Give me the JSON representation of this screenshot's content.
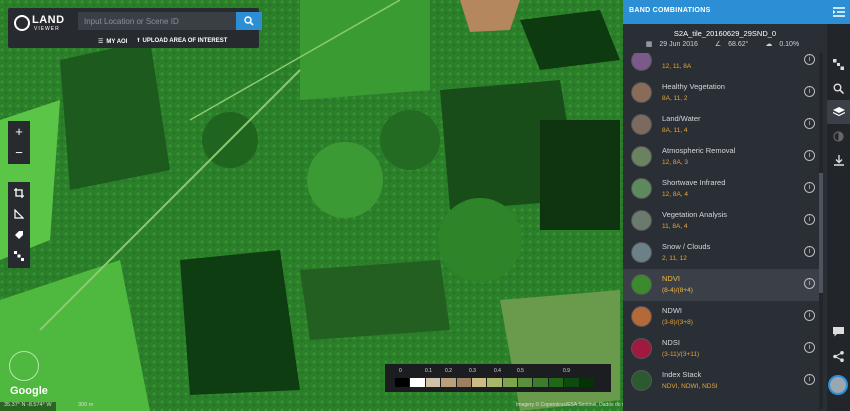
{
  "search": {
    "placeholder": "Input Location or Scene ID"
  },
  "logo": {
    "line1": "LAND",
    "line2": "VIEWER"
  },
  "aoi": {
    "my_aoi": "MY AOI",
    "upload": "UPLOAD AREA OF INTEREST"
  },
  "panel": {
    "title": "BAND COMBINATIONS",
    "tile": "S2A_tile_20160629_29SND_0",
    "date": "29 Jun 2016",
    "angle": "68.62°",
    "cloud": "0.10%"
  },
  "bands": [
    {
      "name": "",
      "combo": "12, 11, 8A",
      "color": "#7b5a8a"
    },
    {
      "name": "Healthy Vegetation",
      "combo": "8A, 11, 2",
      "color": "#8a6b58"
    },
    {
      "name": "Land/Water",
      "combo": "8A, 11, 4",
      "color": "#7a6a60"
    },
    {
      "name": "Atmospheric Removal",
      "combo": "12, 8A, 3",
      "color": "#6a8260"
    },
    {
      "name": "Shortwave Infrared",
      "combo": "12, 8A, 4",
      "color": "#5d8a5c"
    },
    {
      "name": "Vegetation Analysis",
      "combo": "11, 8A, 4",
      "color": "#6a7a6c"
    },
    {
      "name": "Snow / Clouds",
      "combo": "2, 11, 12",
      "color": "#6c8088"
    },
    {
      "name": "NDVI",
      "combo": "(8-4)/(8+4)",
      "color": "#3c8a2e"
    },
    {
      "name": "NDWI",
      "combo": "(3-8)/(3+8)",
      "color": "#b46a38"
    },
    {
      "name": "NDSI",
      "combo": "(3-11)/(3+11)",
      "color": "#a01a40"
    },
    {
      "name": "Index Stack",
      "combo": "NDVI, NDWI, NDSI",
      "color": "#2c5a30"
    }
  ],
  "legend": {
    "labels": [
      "0",
      "0.1",
      "0.2",
      "0.3",
      "0.4",
      "0.5",
      "0.9"
    ],
    "colors": [
      "#000000",
      "#ffffff",
      "#cfc2a9",
      "#b8a07c",
      "#9a8060",
      "#cabc84",
      "#a7b868",
      "#7ea44e",
      "#5a903c",
      "#3c7c2c",
      "#206818",
      "#0e4a10",
      "#063208"
    ]
  },
  "footer": {
    "coords": "35.37° N -8.574° W",
    "scale": "300 m",
    "credits": "Imagery © Copernicus/ESA Sentinel, Dados do mapa ©2017 Google, Inst. Geogr. Nacional   Terms of Use   Report a map error",
    "google": "Google"
  },
  "colors": {
    "accent": "#2c8fd6",
    "panel": "#2a2e35",
    "highlight": "#e6a63c"
  }
}
